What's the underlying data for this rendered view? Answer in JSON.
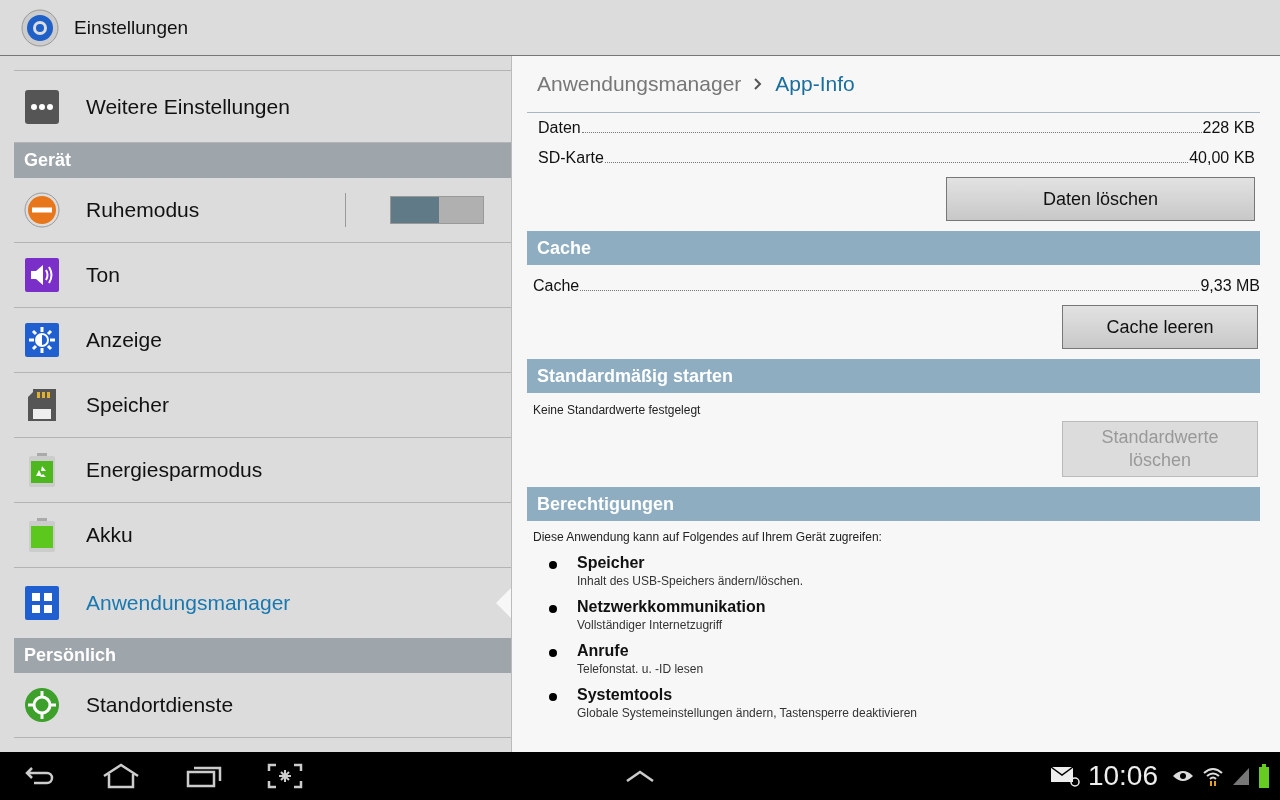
{
  "app_bar": {
    "title": "Einstellungen"
  },
  "sidebar": {
    "items": [
      {
        "kind": "item",
        "label": "Weitere Einstellungen",
        "selected": false
      },
      {
        "kind": "header",
        "label": "Gerät"
      },
      {
        "kind": "toggle",
        "label": "Ruhemodus",
        "selected": false,
        "on": false
      },
      {
        "kind": "item",
        "label": "Ton",
        "selected": false
      },
      {
        "kind": "item",
        "label": "Anzeige",
        "selected": false
      },
      {
        "kind": "item",
        "label": "Speicher",
        "selected": false
      },
      {
        "kind": "item",
        "label": "Energiesparmodus",
        "selected": false
      },
      {
        "kind": "item",
        "label": "Akku",
        "selected": false
      },
      {
        "kind": "item",
        "label": "Anwendungsmanager",
        "selected": true
      },
      {
        "kind": "header",
        "label": "Persönlich"
      },
      {
        "kind": "item",
        "label": "Standortdienste",
        "selected": false
      }
    ]
  },
  "breadcrumb": {
    "parent": "Anwendungsmanager",
    "current": "App-Info"
  },
  "storage": {
    "rows": [
      {
        "label": "Daten",
        "value": "228 KB"
      },
      {
        "label": "SD-Karte",
        "value": "40,00 KB"
      }
    ],
    "button": {
      "label": "Daten löschen",
      "disabled": false
    }
  },
  "cache": {
    "title": "Cache",
    "rows": [
      {
        "label": "Cache",
        "value": "9,33 MB"
      }
    ],
    "button": {
      "label": "Cache leeren",
      "disabled": false
    }
  },
  "launch_default": {
    "title": "Standardmäßig starten",
    "note": "Keine Standardwerte festgelegt",
    "button": {
      "label": "Standardwerte löschen",
      "disabled": true
    }
  },
  "permissions": {
    "title": "Berechtigungen",
    "intro": "Diese Anwendung kann auf Folgendes auf Ihrem Gerät zugreifen:",
    "items": [
      {
        "name": "Speicher",
        "description": "Inhalt des USB-Speichers ändern/löschen."
      },
      {
        "name": "Netzwerkkommunikation",
        "description": "Vollständiger Internetzugriff"
      },
      {
        "name": "Anrufe",
        "description": "Telefonstat. u. -ID lesen"
      },
      {
        "name": "Systemtools",
        "description": "Globale Systemeinstellungen ändern, Tastensperre deaktivieren"
      }
    ]
  },
  "nav_bar": {
    "time": "10:06"
  }
}
